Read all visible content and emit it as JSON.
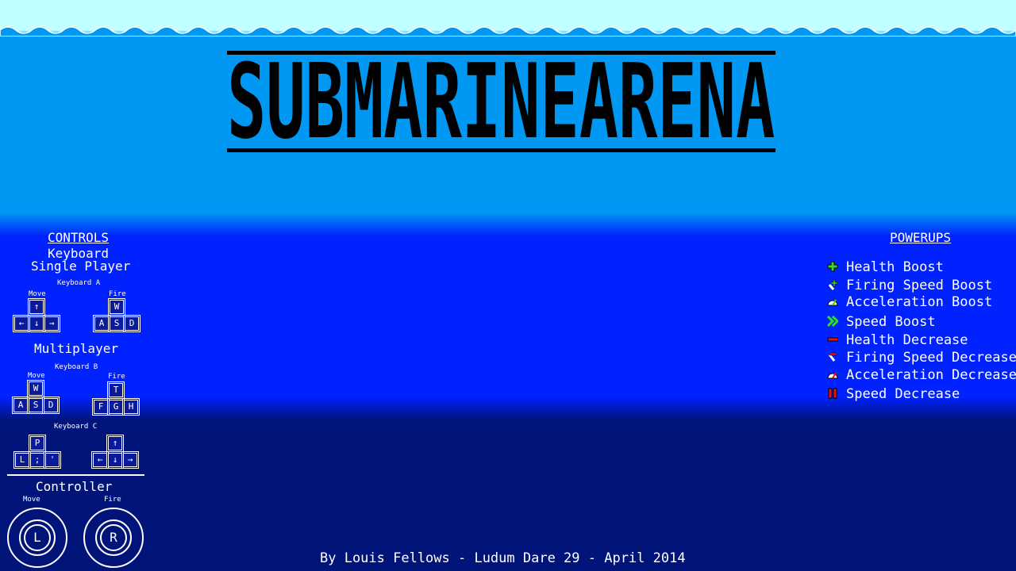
{
  "title": "SUBMARINEARENA",
  "controls": {
    "heading": "CONTROLS",
    "keyboard": "Keyboard",
    "single_player": "Single Player",
    "kb_a": "Keyboard A",
    "move": "Move",
    "fire": "Fire",
    "multiplayer": "Multiplayer",
    "kb_b": "Keyboard B",
    "kb_c": "Keyboard C",
    "controller": "Controller",
    "keys_a_move": [
      "↑",
      "←",
      "↓",
      "→"
    ],
    "keys_a_fire": [
      "W",
      "A",
      "S",
      "D"
    ],
    "keys_b_move": [
      "W",
      "A",
      "S",
      "D"
    ],
    "keys_b_fire": [
      "T",
      "F",
      "G",
      "H"
    ],
    "keys_c_move": [
      "P",
      "L",
      ";",
      "'"
    ],
    "keys_c_fire": [
      "↑",
      "←",
      "↓",
      "→"
    ],
    "stick_left": "L",
    "stick_right": "R"
  },
  "powerups": {
    "heading": "POWERUPS",
    "items": [
      {
        "label": "Health Boost",
        "icon": "plus-icon",
        "color": "#33dd22"
      },
      {
        "label": "Firing Speed Boost",
        "icon": "firing-boost-icon",
        "color": "#33dd22"
      },
      {
        "label": "Acceleration Boost",
        "icon": "gauge-icon",
        "color": "#33dd22"
      },
      {
        "label": "Speed Boost",
        "icon": "double-chevron-icon",
        "color": "#33dd22"
      },
      {
        "label": "Health Decrease",
        "icon": "minus-icon",
        "color": "#ee1111"
      },
      {
        "label": "Firing Speed Decrease",
        "icon": "firing-decrease-icon",
        "color": "#ee1111"
      },
      {
        "label": "Acceleration Decrease",
        "icon": "gauge-icon",
        "color": "#ee1111"
      },
      {
        "label": "Speed Decrease",
        "icon": "pause-icon",
        "color": "#ee1111"
      }
    ]
  },
  "footer": "By Louis Fellows - Ludum Dare 29 - April 2014"
}
